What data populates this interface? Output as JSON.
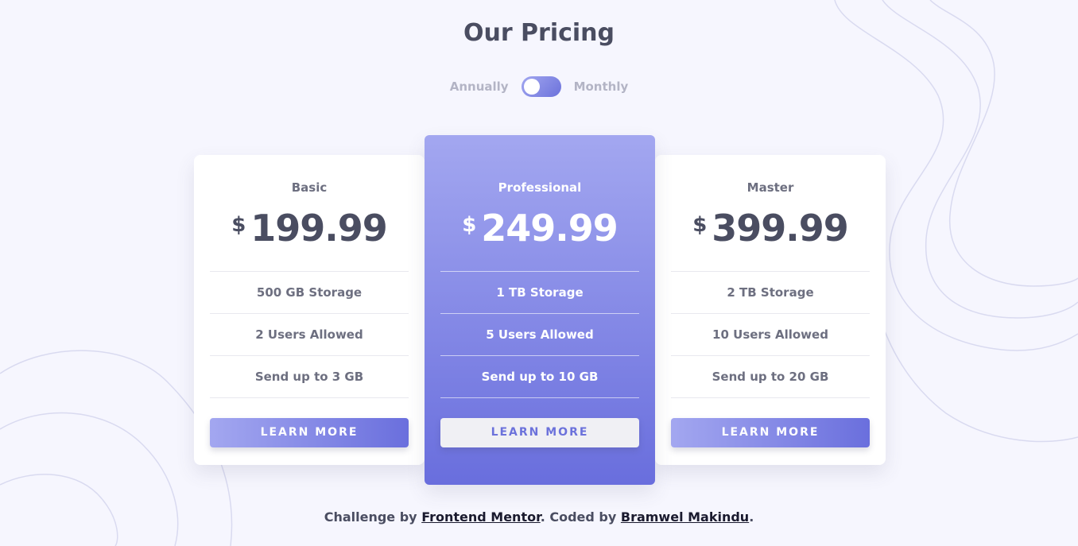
{
  "page": {
    "title": "Our Pricing"
  },
  "billing_toggle": {
    "left_label": "Annually",
    "right_label": "Monthly",
    "state": "annually"
  },
  "plans": [
    {
      "name": "Basic",
      "currency": "$",
      "price": "199.99",
      "features": [
        "500 GB Storage",
        "2 Users Allowed",
        "Send up to 3 GB"
      ],
      "button_label": "LEARN MORE"
    },
    {
      "name": "Professional",
      "currency": "$",
      "price": "249.99",
      "features": [
        "1 TB Storage",
        "5 Users Allowed",
        "Send up to 10 GB"
      ],
      "button_label": "LEARN MORE",
      "highlighted": true
    },
    {
      "name": "Master",
      "currency": "$",
      "price": "399.99",
      "features": [
        "2 TB Storage",
        "10 Users Allowed",
        "Send up to 20 GB"
      ],
      "button_label": "LEARN MORE"
    }
  ],
  "footer": {
    "prefix": "Challenge by",
    "link1": "Frontend Mentor",
    "middle": ". Coded by",
    "link2": "Bramwel Makindu",
    "suffix": "."
  },
  "colors": {
    "background": "#f6f6fe",
    "accent_light": "#a3a7f0",
    "accent_dark": "#696edd",
    "text_dark": "#4a4d61",
    "text_muted": "#6d6f80"
  }
}
